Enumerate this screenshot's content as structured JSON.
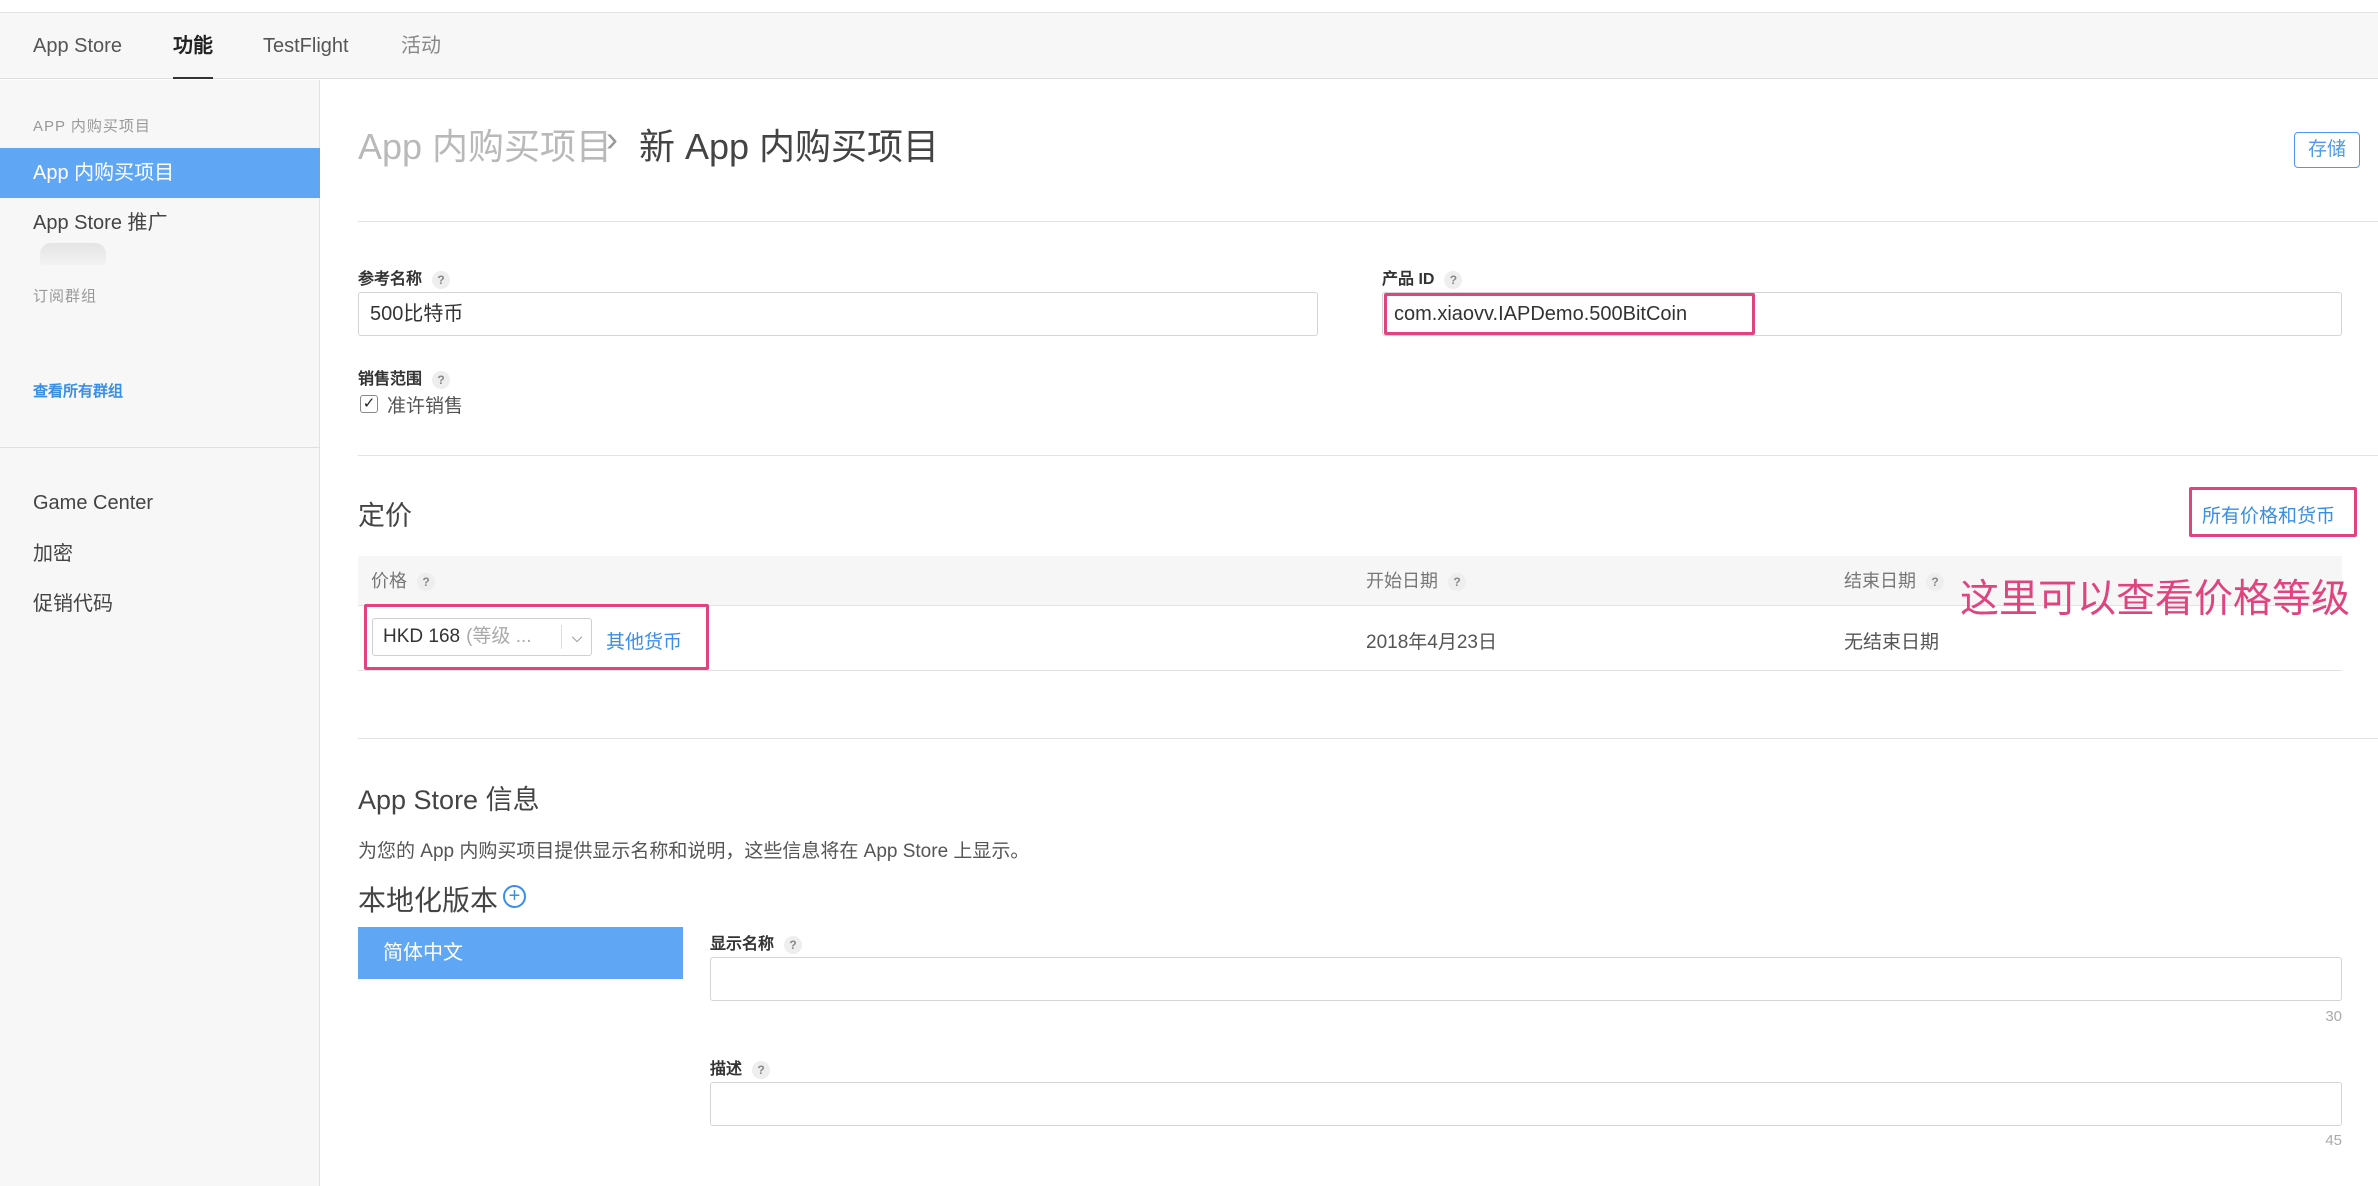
{
  "tabs": [
    {
      "label": "App Store"
    },
    {
      "label": "功能"
    },
    {
      "label": "TestFlight"
    },
    {
      "label": "活动"
    }
  ],
  "sidebar": {
    "section1_title": "APP 内购买项目",
    "item_iap": "App 内购买项目",
    "item_promo": "App Store 推广",
    "section2_title": "订阅群组",
    "view_all_groups": "查看所有群组",
    "item_game_center": "Game Center",
    "item_encryption": "加密",
    "item_promo_codes": "促销代码"
  },
  "header": {
    "breadcrumb_parent": "App 内购买项目",
    "breadcrumb_sep": "›",
    "breadcrumb_current": "新 App 内购买项目",
    "save_label": "存储"
  },
  "form": {
    "ref_name_label": "参考名称",
    "ref_name_value": "500比特币",
    "product_id_label": "产品 ID",
    "product_id_value": "com.xiaovv.IAPDemo.500BitCoin",
    "availability_label": "销售范围",
    "cleared_for_sale_label": "准许销售",
    "cleared_for_sale_checked": true,
    "help_glyph": "?"
  },
  "pricing": {
    "title": "定价",
    "all_prices_link": "所有价格和货币",
    "col_price": "价格",
    "col_start": "开始日期",
    "col_end": "结束日期",
    "price_value": "HKD 168",
    "price_tier": "(等级 ...",
    "other_currencies": "其他货币",
    "start_date": "2018年4月23日",
    "end_date": "无结束日期"
  },
  "annotation": {
    "text": "这里可以查看价格等级",
    "color": "#e0447f"
  },
  "store_info": {
    "title": "App Store 信息",
    "description": "为您的 App 内购买项目提供显示名称和说明，这些信息将在 App Store 上显示。",
    "localization_title": "本地化版本",
    "language_tab": "简体中文",
    "display_name_label": "显示名称",
    "display_name_value": "",
    "display_name_limit": "30",
    "description_label": "描述",
    "description_value": "",
    "description_limit": "45"
  },
  "colors": {
    "accent": "#3a8ee6",
    "sidebar_active": "#5fa7f5",
    "highlight": "#e0447f"
  }
}
